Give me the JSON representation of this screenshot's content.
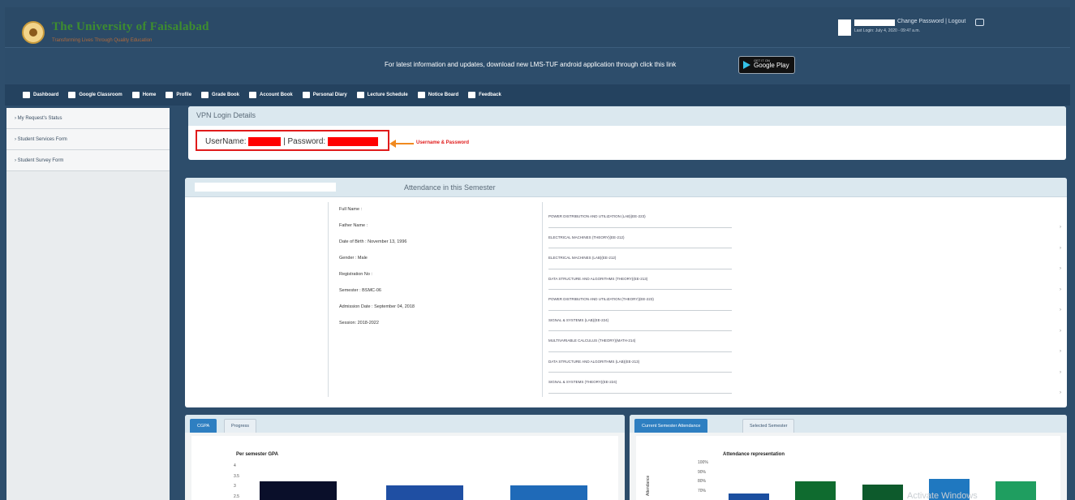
{
  "header": {
    "university_name": "The University of Faisalabad",
    "university_subtitle": "Transforming Lives Through Quality Education",
    "user_links": "Change Password | Logout",
    "last_login": "Last Login: July 4, 2020 - 09:47 a.m."
  },
  "banner": {
    "text": "For latest information and updates, download new LMS-TUF android application through click this link",
    "store_small": "GET IT ON",
    "store_label": "Google Play"
  },
  "nav": {
    "items": [
      {
        "label": "Dashboard",
        "icon": "dashboard-icon"
      },
      {
        "label": "Google Classroom",
        "icon": "google-icon"
      },
      {
        "label": "Home",
        "icon": "home-icon"
      },
      {
        "label": "Profile",
        "icon": "user-icon"
      },
      {
        "label": "Grade Book",
        "icon": "pencil-icon"
      },
      {
        "label": "Account Book",
        "icon": "card-icon"
      },
      {
        "label": "Personal Diary",
        "icon": "edit-icon"
      },
      {
        "label": "Lecture Schedule",
        "icon": "calendar-icon"
      },
      {
        "label": "Notice Board",
        "icon": "document-icon"
      },
      {
        "label": "Feedback",
        "icon": "document-icon"
      }
    ]
  },
  "sidebar": {
    "items": [
      {
        "label": "My Request's Status"
      },
      {
        "label": "Student Services Form"
      },
      {
        "label": "Student Survey Form"
      }
    ]
  },
  "vpn": {
    "title": "VPN Login Details",
    "username_label": "UserName:",
    "password_label": "| Password:",
    "annotation": "Username & Password"
  },
  "attendance": {
    "title": "Attendance in this Semester",
    "info": [
      "Full Name :",
      "Father Name :",
      "Date of Birth : November 13, 1996",
      "Gender : Male",
      "Registration No :",
      "Semester : BSMC-06",
      "Admission Date : September 04, 2018",
      "Session: 2018-2022"
    ],
    "courses": [
      "POWER DISTRIBUTION AND UTILIZATION (LAB)(EE-223)",
      "ELECTRICAL MACHINES (THEORY)(EE-212)",
      "ELECTRICAL MACHINES (LAB)(EE-212)",
      "DATA STRUCTURE AND ALGORITHMS (THEORY)(EE-213)",
      "POWER DISTRIBUTION AND UTILIZATION (THEORY)(EE-223)",
      "SIGNAL & SYSTEMS (LAB)(EE-224)",
      "MULTIVARIABLE CALCULUS (THEORY)(MATH-214)",
      "DATA STRUCTURE AND ALGORITHMS (LAB)(EE-213)",
      "SIGNAL & SYSTEMS (THEORY)(EE-224)"
    ]
  },
  "gpa_panel": {
    "tabs": [
      "CGPA",
      "Progress"
    ],
    "chart_title": "Per semester GPA",
    "yticks": [
      "4",
      "3.5",
      "3",
      "2.5"
    ]
  },
  "attendance_panel": {
    "tabs": [
      "Current Semester Attendance",
      "Selected Semester"
    ],
    "chart_title": "Attendance representation",
    "ylabel": "Attendance",
    "yticks": [
      "100%",
      "90%",
      "80%",
      "70%"
    ],
    "watermark": "Activate Windows"
  },
  "chart_data": [
    {
      "type": "bar",
      "title": "Per semester GPA",
      "ylim": [
        2.5,
        4
      ],
      "values": [
        3.45,
        3.3,
        3.3
      ],
      "colors": [
        "#0a0f2a",
        "#1f4fa3",
        "#1f6ab8"
      ]
    },
    {
      "type": "bar",
      "title": "Attendance representation",
      "ylabel": "Attendance",
      "ylim": [
        70,
        100
      ],
      "values": [
        79,
        87,
        85,
        89,
        87
      ],
      "colors": [
        "#1b4fa0",
        "#0f6b2f",
        "#0d5a2c",
        "#1f78c0",
        "#1f9e60"
      ]
    }
  ]
}
